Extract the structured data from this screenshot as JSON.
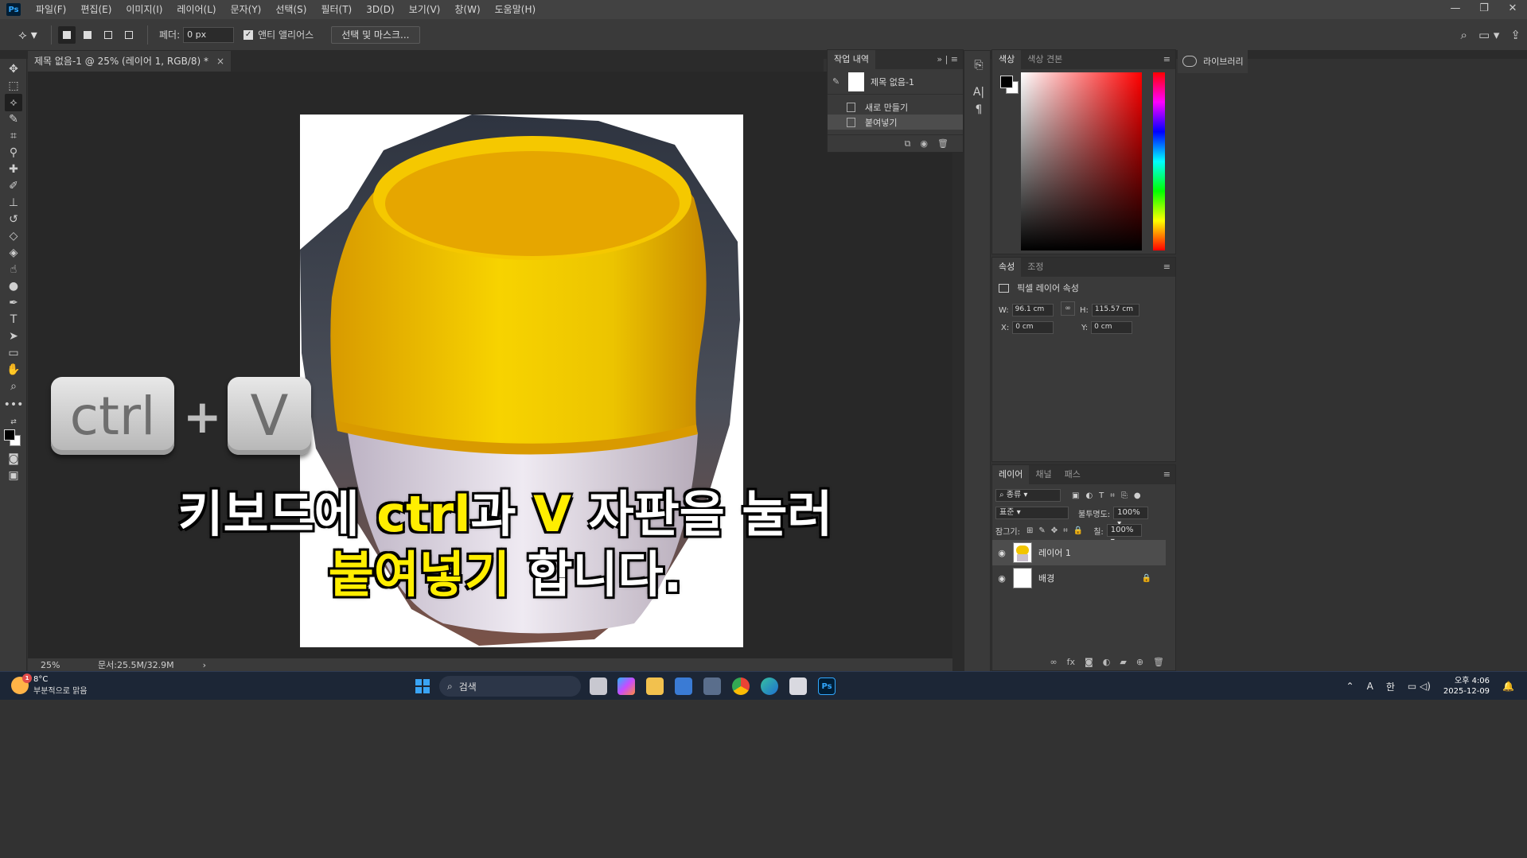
{
  "menubar": {
    "logo": "Ps",
    "items": [
      "파일(F)",
      "편집(E)",
      "이미지(I)",
      "레이어(L)",
      "문자(Y)",
      "선택(S)",
      "필터(T)",
      "3D(D)",
      "보기(V)",
      "창(W)",
      "도움말(H)"
    ],
    "window_controls": [
      "—",
      "❐",
      "✕"
    ]
  },
  "options": {
    "feather_label": "페더:",
    "feather_value": "0 px",
    "antialias_label": "앤티 앨리어스",
    "select_mask_label": "선택 및 마스크..."
  },
  "document": {
    "tab_title": "제목 없음-1 @ 25% (레이어 1, RGB/8) *",
    "tab_close": "×"
  },
  "status": {
    "zoom": "25%",
    "doc_size": "문서:25.5M/32.9M",
    "arrow": "›"
  },
  "history": {
    "tab": "작업 내역",
    "expand": "»",
    "snapshot": "제목 없음-1",
    "items": [
      "새로 만들기",
      "붙여넣기"
    ]
  },
  "color": {
    "tabs": [
      "색상",
      "색상 견본"
    ]
  },
  "properties": {
    "tabs": [
      "속성",
      "조정"
    ],
    "heading": "픽셀 레이어 속성",
    "w_label": "W:",
    "w_value": "96.1 cm",
    "h_label": "H:",
    "h_value": "115.57 cm",
    "x_label": "X:",
    "x_value": "0 cm",
    "y_label": "Y:",
    "y_value": "0 cm"
  },
  "layers": {
    "tabs": [
      "레이어",
      "채널",
      "패스"
    ],
    "kind_filter": "종류",
    "blend_mode": "표준",
    "opacity_label": "불투명도:",
    "opacity_value": "100%",
    "lock_label": "잠그기:",
    "fill_label": "칠:",
    "fill_value": "100%",
    "items": [
      {
        "name": "레이어 1"
      },
      {
        "name": "배경"
      }
    ]
  },
  "libraries": {
    "label": "라이브러리"
  },
  "overlay": {
    "key_ctrl": "ctrl",
    "plus": "+",
    "key_v": "V",
    "line1_pre": "키보드에 ",
    "line1_hl1": "ctrl",
    "line1_mid": "과 ",
    "line1_hl2": "V",
    "line1_post": " 자판을 눌러",
    "line2_hl": "붙여넣기",
    "line2_post": " 합니다."
  },
  "taskbar": {
    "weather_temp": "8°C",
    "weather_desc": "부분적으로 맑음",
    "weather_badge": "1",
    "search_placeholder": "검색",
    "ime_a": "A",
    "ime_han": "한",
    "time": "오후 4:06",
    "date": "2025-12-09"
  },
  "colors": {
    "accent_yellow": "#ffee00",
    "ps_blue": "#31a8ff"
  }
}
